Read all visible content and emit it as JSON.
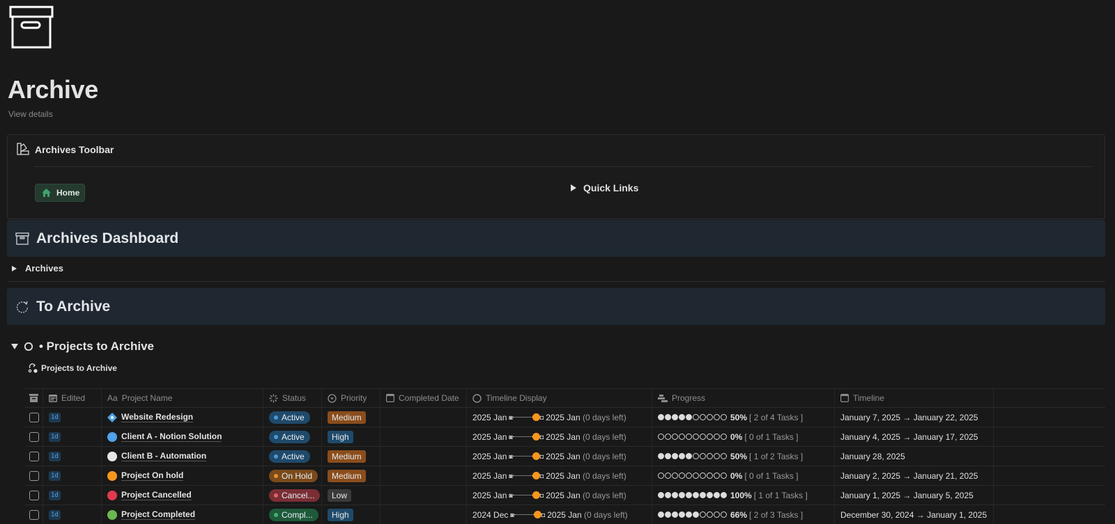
{
  "page": {
    "icon": "archive-box-icon",
    "title": "Archive",
    "view_details": "View details"
  },
  "toolbar": {
    "icon": "swatches-icon",
    "title": "Archives Toolbar",
    "home_button": {
      "icon": "home-icon",
      "label": "Home"
    },
    "quick_links": "Quick Links"
  },
  "dashboard": {
    "icon": "archive-box-icon",
    "title": "Archives Dashboard",
    "toggle_label": "Archives"
  },
  "to_archive": {
    "icon": "loading-circle-icon",
    "title": "To Archive"
  },
  "projects_section": {
    "icon": "circle-icon",
    "title": "• Projects to Archive",
    "view_icon": "workflow-icon",
    "view_name": "Projects to Archive"
  },
  "table": {
    "columns": [
      {
        "key": "archive",
        "label": "",
        "icon": "archive-icon"
      },
      {
        "key": "edited",
        "label": "Edited",
        "icon": "calendar-icon"
      },
      {
        "key": "name",
        "label": "Project Name",
        "icon": "text-icon"
      },
      {
        "key": "status",
        "label": "Status",
        "icon": "status-icon"
      },
      {
        "key": "priority",
        "label": "Priority",
        "icon": "select-icon"
      },
      {
        "key": "completed",
        "label": "Completed Date",
        "icon": "calendar-icon"
      },
      {
        "key": "timeline_display",
        "label": "Timeline Display",
        "icon": "formula-icon"
      },
      {
        "key": "progress",
        "label": "Progress",
        "icon": "rollup-icon"
      },
      {
        "key": "timeline",
        "label": "Timeline",
        "icon": "calendar-icon"
      }
    ],
    "rows": [
      {
        "edited": "1d",
        "name": "Website Redesign",
        "icon_color": "#4fa3e8",
        "icon_shape": "diamond",
        "status": "Active",
        "status_bg": "#1f4a6b",
        "status_dot": "#4b98d6",
        "priority": "Medium",
        "priority_bg": "#8a4d1c",
        "completed": "",
        "tl_start": "2025 Jan",
        "tl_end": "2025 Jan",
        "tl_left": "(0 days left)",
        "progress_filled": 5,
        "progress_total": 10,
        "progress_pct": "50%",
        "progress_tasks": "[ 2 of 4 Tasks ]",
        "timeline": "January 7, 2025 → January 22, 2025"
      },
      {
        "edited": "1d",
        "name": "Client A - Notion Solution",
        "icon_color": "#4fa3e8",
        "icon_shape": "circle",
        "status": "Active",
        "status_bg": "#1f4a6b",
        "status_dot": "#4b98d6",
        "priority": "High",
        "priority_bg": "#1f4a6b",
        "completed": "",
        "tl_start": "2025 Jan",
        "tl_end": "2025 Jan",
        "tl_left": "(0 days left)",
        "progress_filled": 0,
        "progress_total": 10,
        "progress_pct": "0%",
        "progress_tasks": "[ 0 of 1 Tasks ]",
        "timeline": "January 4, 2025 → January 17, 2025"
      },
      {
        "edited": "1d",
        "name": "Client B - Automation",
        "icon_color": "#e6e6e6",
        "icon_shape": "circle",
        "status": "Active",
        "status_bg": "#1f4a6b",
        "status_dot": "#4b98d6",
        "priority": "Medium",
        "priority_bg": "#8a4d1c",
        "completed": "",
        "tl_start": "2025 Jan",
        "tl_end": "2025 Jan",
        "tl_left": "(0 days left)",
        "progress_filled": 5,
        "progress_total": 10,
        "progress_pct": "50%",
        "progress_tasks": "[ 1 of 2 Tasks ]",
        "timeline": "January 28, 2025"
      },
      {
        "edited": "1d",
        "name": "Project On hold",
        "icon_color": "#f6961e",
        "icon_shape": "circle",
        "status": "On Hold",
        "status_bg": "#7a4a1a",
        "status_dot": "#e8902e",
        "priority": "Medium",
        "priority_bg": "#8a4d1c",
        "completed": "",
        "tl_start": "2025 Jan",
        "tl_end": "2025 Jan",
        "tl_left": "(0 days left)",
        "progress_filled": 0,
        "progress_total": 10,
        "progress_pct": "0%",
        "progress_tasks": "[ 0 of 1 Tasks ]",
        "timeline": "January 2, 2025 → January 21, 2025"
      },
      {
        "edited": "1d",
        "name": "Project Cancelled",
        "icon_color": "#e03a4e",
        "icon_shape": "circle",
        "status": "Cancel...",
        "status_bg": "#7a2e34",
        "status_dot": "#e0616b",
        "priority": "Low",
        "priority_bg": "#3a3a3a",
        "completed": "",
        "tl_start": "2025 Jan",
        "tl_end": "2025 Jan",
        "tl_left": "(0 days left)",
        "progress_filled": 10,
        "progress_total": 10,
        "progress_pct": "100%",
        "progress_tasks": "[ 1 of 1 Tasks ]",
        "timeline": "January 1, 2025 → January 5, 2025"
      },
      {
        "edited": "1d",
        "name": "Project Completed",
        "icon_color": "#6ab84f",
        "icon_shape": "circle",
        "status": "Compl...",
        "status_bg": "#1e5a3a",
        "status_dot": "#3fb26f",
        "priority": "High",
        "priority_bg": "#1f4a6b",
        "completed": "",
        "tl_start": "2024 Dec",
        "tl_end": "2025 Jan",
        "tl_left": "(0 days left)",
        "progress_filled": 6,
        "progress_total": 10,
        "progress_pct": "66%",
        "progress_tasks": "[ 2 of 3 Tasks ]",
        "timeline": "December 30, 2024 → January 1, 2025"
      }
    ]
  }
}
